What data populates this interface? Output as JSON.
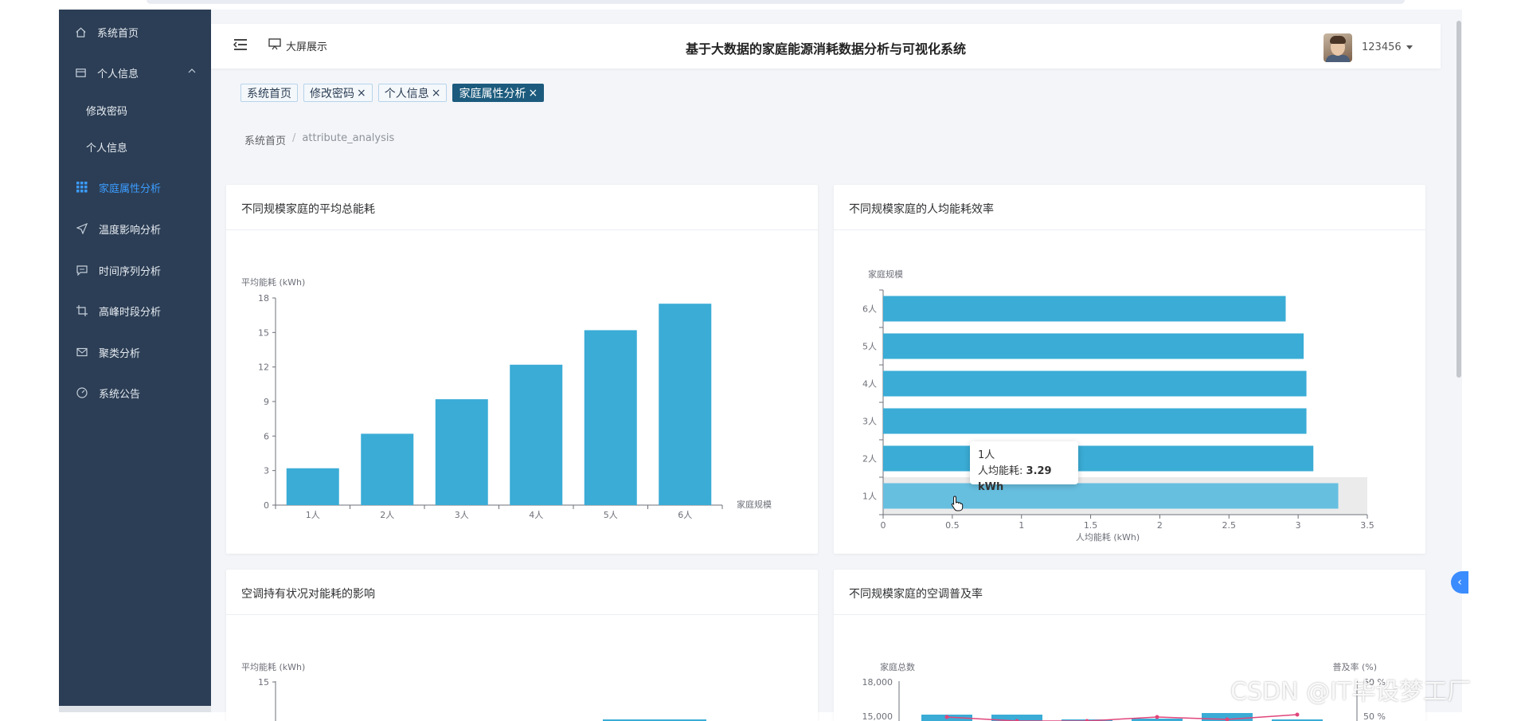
{
  "sidebar": {
    "items": [
      {
        "label": "系统首页",
        "icon": "home-icon"
      },
      {
        "label": "个人信息",
        "icon": "card-icon"
      },
      {
        "label": "修改密码"
      },
      {
        "label": "个人信息"
      },
      {
        "label": "家庭属性分析",
        "icon": "grid-icon"
      },
      {
        "label": "温度影响分析",
        "icon": "send-icon"
      },
      {
        "label": "时间序列分析",
        "icon": "chat-icon"
      },
      {
        "label": "高峰时段分析",
        "icon": "crop-icon"
      },
      {
        "label": "聚类分析",
        "icon": "mail-icon"
      },
      {
        "label": "系统公告",
        "icon": "gauge-icon"
      }
    ],
    "active_color": "#3b9cff"
  },
  "header": {
    "screen_label": "大屏展示",
    "title": "基于大数据的家庭能源消耗数据分析与可视化系统",
    "username": "123456"
  },
  "tags": [
    {
      "label": "系统首页"
    },
    {
      "label": "修改密码",
      "close": "×"
    },
    {
      "label": "个人信息",
      "close": "×"
    },
    {
      "label": "家庭属性分析",
      "close": "×"
    }
  ],
  "breadcrumb": {
    "home": "系统首页",
    "sep": "/",
    "current": "attribute_analysis"
  },
  "cards": {
    "c1": {
      "title": "不同规模家庭的平均总能耗"
    },
    "c2": {
      "title": "不同规模家庭的人均能耗效率"
    },
    "c3": {
      "title": "空调持有状况对能耗的影响"
    },
    "c4": {
      "title": "不同规模家庭的空调普及率"
    }
  },
  "tooltip": {
    "category": "1人",
    "series_label": "人均能耗",
    "value_text": "3.29 kWh"
  },
  "watermark": "CSDN @IT毕设梦工厂",
  "chart_data": [
    {
      "type": "bar",
      "categories": [
        "1人",
        "2人",
        "3人",
        "4人",
        "5人",
        "6人"
      ],
      "values": [
        3.2,
        6.2,
        9.2,
        12.2,
        15.2,
        17.5
      ],
      "ylabel": "平均能耗 (kWh)",
      "xlabel": "家庭规模",
      "ylim": [
        0,
        18
      ],
      "yticks": [
        0,
        3,
        6,
        9,
        12,
        15,
        18
      ],
      "color": "#3aacd6"
    },
    {
      "type": "bar",
      "orientation": "horizontal",
      "categories": [
        "1人",
        "2人",
        "3人",
        "4人",
        "5人",
        "6人"
      ],
      "values": [
        3.29,
        3.11,
        3.06,
        3.06,
        3.04,
        2.91
      ],
      "ylabel": "家庭规模",
      "xlabel": "人均能耗 (kWh)",
      "xlim": [
        0,
        3.5
      ],
      "xticks": [
        "0",
        "0.5",
        "1",
        "1.5",
        "2",
        "2.5",
        "3",
        "3.5"
      ],
      "highlight_index": 0,
      "color": "#3aacd6",
      "highlight_color": "#67bfe0"
    },
    {
      "type": "bar",
      "ylabel": "平均能耗 (kWh)",
      "yticks_visible": [
        "15"
      ]
    },
    {
      "type": "bar",
      "ylabel_left": "家庭总数",
      "ylabel_right": "普及率 (%)",
      "yticks_left_visible": [
        "18,000",
        "15,000"
      ],
      "yticks_right_visible": [
        "60 %",
        "50 %"
      ]
    }
  ]
}
